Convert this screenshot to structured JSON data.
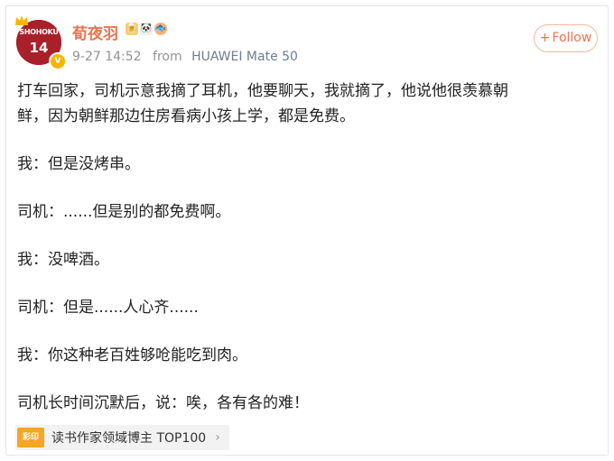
{
  "post": {
    "author": {
      "name": "荀夜羽",
      "avatar_text": "SHOHOKU",
      "avatar_number": "14",
      "verified_mark": "V"
    },
    "meta": {
      "date": "9-27 14:52",
      "from_label": "from",
      "source": "HUAWEI Mate 50"
    },
    "follow_button": {
      "icon": "+",
      "label": "Follow"
    },
    "content": {
      "paragraphs": [
        "打车回家，司机示意我摘了耳机，他要聊天，我就摘了，他说他很羡慕朝",
        "鲜，因为朝鲜那边住房看病小孩上学，都是免费。",
        "我：但是没烤串。",
        "司机：......但是别的都免费啊。",
        "我：没啤酒。",
        "司机：但是......人心齐......",
        "我：你这种老百姓够呛能吃到肉。",
        "司机长时间沉默后，说：唉，各有各的难！"
      ]
    },
    "honor_tag": {
      "icon_text": "彩印",
      "text": "读书作家领域博主 TOP100",
      "arrow": "›"
    }
  },
  "colors": {
    "name": "#eb7350",
    "text": "#222222",
    "meta": "#939393",
    "verified": "#f7b500",
    "follow_border": "#f2b99f"
  }
}
